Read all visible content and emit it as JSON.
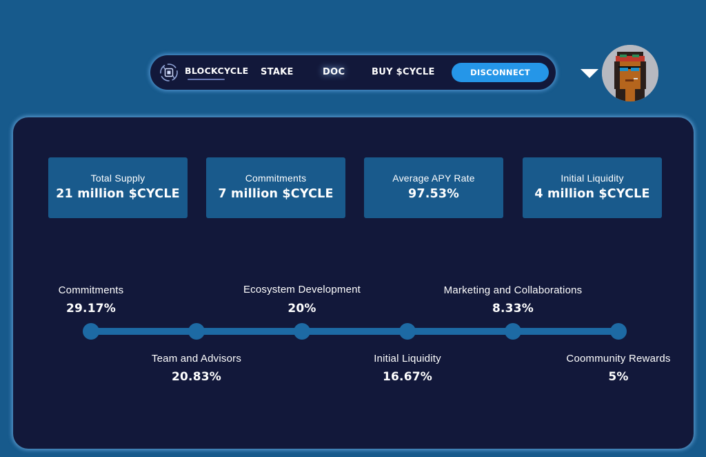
{
  "nav": {
    "brand": "BLOCKCYCLE",
    "links": [
      "STAKE",
      "DOC",
      "BUY $CYCLE"
    ],
    "disconnect_label": "DISCONNECT",
    "accent_color": "#2596e8"
  },
  "user": {
    "avatar": "pixel-art-avatar"
  },
  "stats": [
    {
      "label": "Total Supply",
      "value": "21 million $CYCLE"
    },
    {
      "label": "Commitments",
      "value": "7 million $CYCLE"
    },
    {
      "label": "Average APY Rate",
      "value": "97.53%"
    },
    {
      "label": "Initial Liquidity",
      "value": "4 million $CYCLE"
    }
  ],
  "distribution": [
    {
      "label": "Commitments",
      "percent": "29.17%"
    },
    {
      "label": "Team and Advisors",
      "percent": "20.83%"
    },
    {
      "label": "Ecosystem Development",
      "percent": "20%"
    },
    {
      "label": "Initial Liquidity",
      "percent": "16.67%"
    },
    {
      "label": "Marketing and Collaborations",
      "percent": "8.33%"
    },
    {
      "label": "Coommunity Rewards",
      "percent": "5%"
    }
  ],
  "colors": {
    "background": "#175a8c",
    "panel": "#12183a",
    "card": "#195a8c",
    "timeline": "#1d6aa4"
  }
}
